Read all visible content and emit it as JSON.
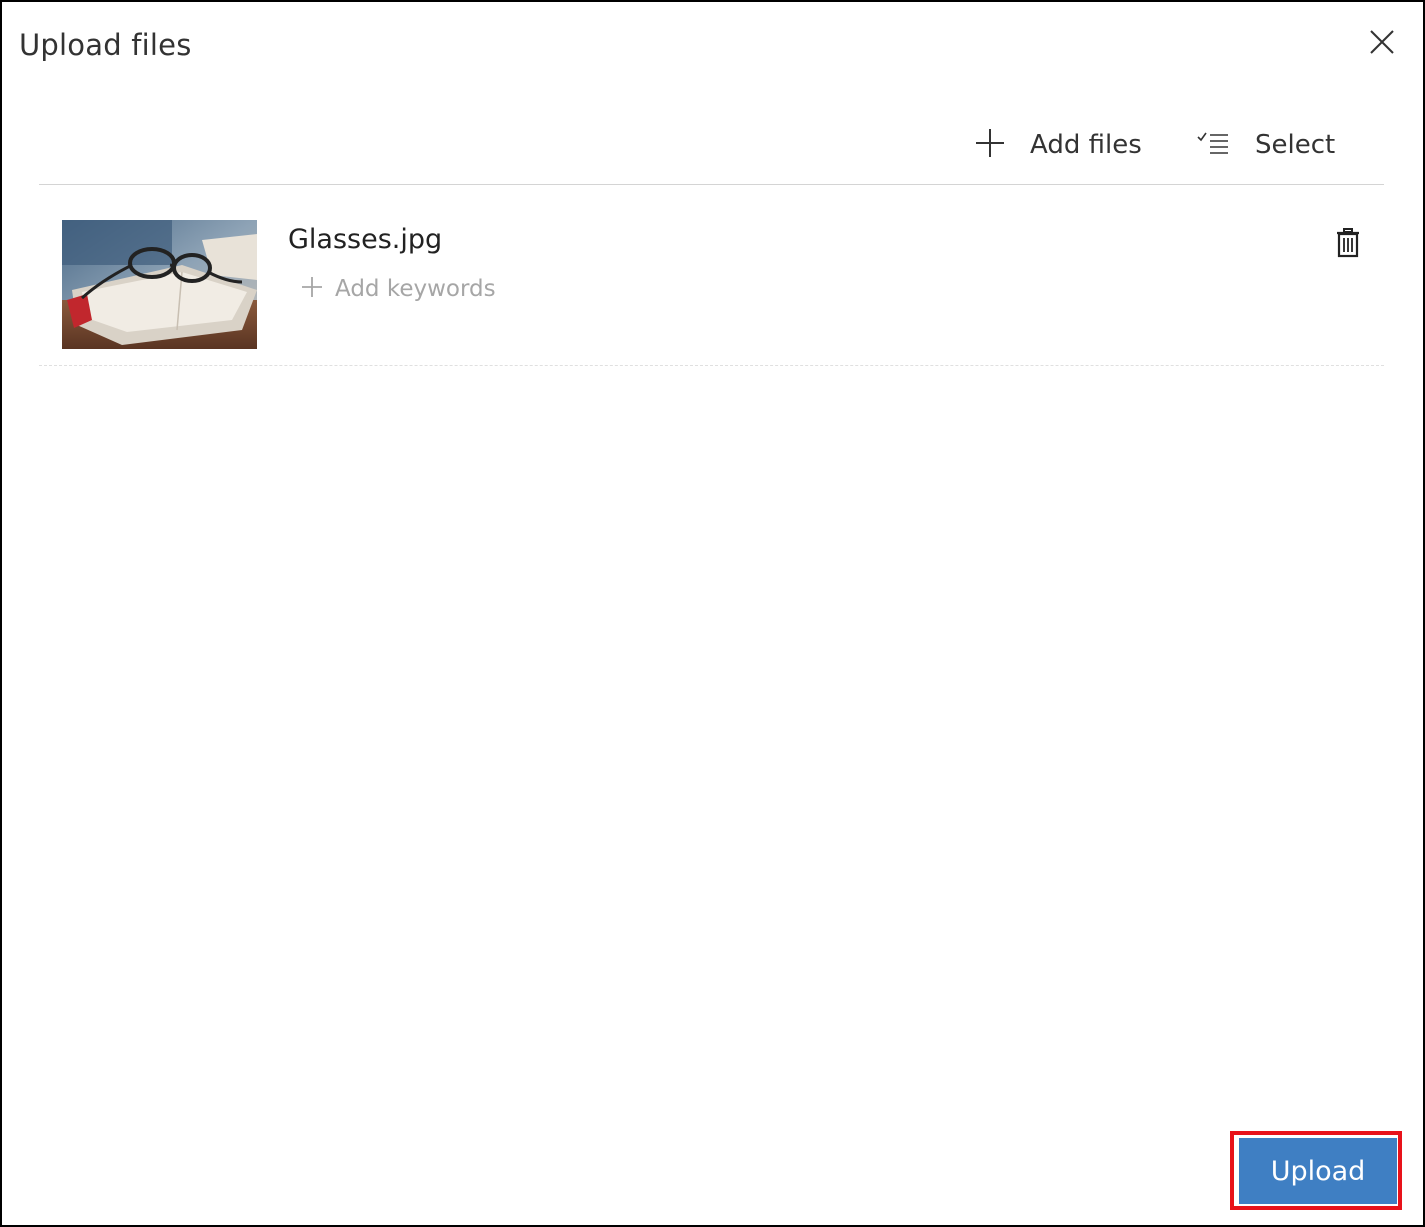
{
  "dialog": {
    "title": "Upload files",
    "close_icon": "close-icon"
  },
  "toolbar": {
    "add_files_label": "Add files",
    "add_files_icon": "plus-icon",
    "select_label": "Select",
    "select_icon": "checklist-icon"
  },
  "files": [
    {
      "name": "Glasses.jpg",
      "thumbnail_icon": "image-thumbnail",
      "add_keywords_label": "Add keywords",
      "add_keywords_icon": "plus-icon",
      "delete_icon": "trash-icon"
    }
  ],
  "footer": {
    "upload_label": "Upload"
  },
  "colors": {
    "accent": "#3f7fc3",
    "highlight": "#e8121a",
    "text": "#333333",
    "muted": "#a6a6a6"
  }
}
